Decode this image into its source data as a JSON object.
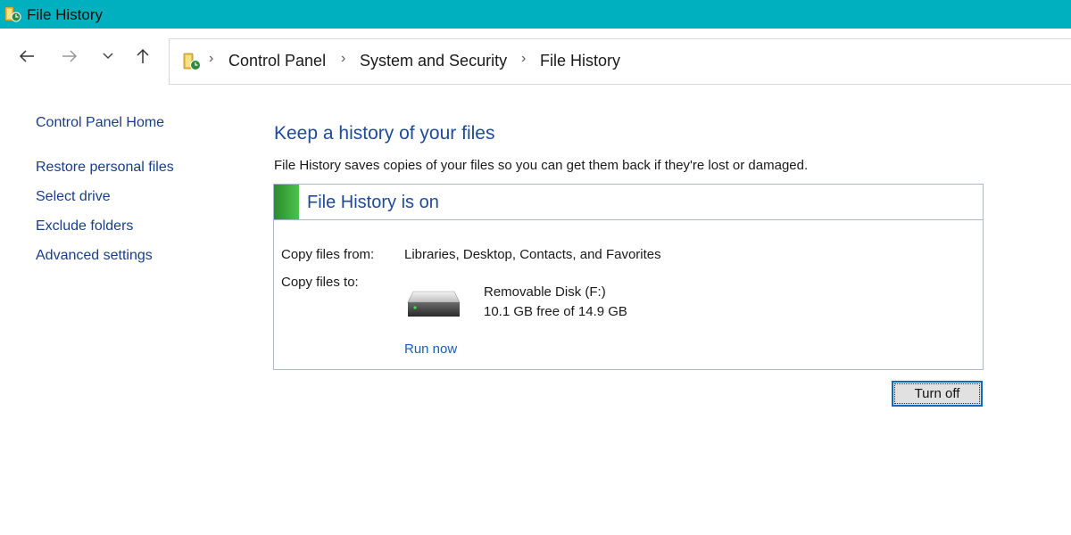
{
  "window": {
    "title": "File History",
    "accent_color": "#00b0bf"
  },
  "nav": {
    "back_icon": "arrow-left-icon",
    "forward_icon": "arrow-right-icon",
    "recent_icon": "chevron-down-icon",
    "up_icon": "arrow-up-icon"
  },
  "address": {
    "location_icon": "file-history-icon",
    "crumbs": [
      "Control Panel",
      "System and Security",
      "File History"
    ]
  },
  "sidebar": {
    "home": "Control Panel Home",
    "links": [
      "Restore personal files",
      "Select drive",
      "Exclude folders",
      "Advanced settings"
    ]
  },
  "main": {
    "heading": "Keep a history of your files",
    "description": "File History saves copies of your files so you can get them back if they're lost or damaged.",
    "status": {
      "text": "File History is on",
      "color": "#3aa83a"
    },
    "copy_from_label": "Copy files from:",
    "copy_from_value": "Libraries, Desktop, Contacts, and Favorites",
    "copy_to_label": "Copy files to:",
    "drive": {
      "icon": "hard-drive-icon",
      "name": "Removable Disk (F:)",
      "free": "10.1 GB free of 14.9 GB"
    },
    "run_now": "Run now",
    "turn_off": "Turn off"
  }
}
